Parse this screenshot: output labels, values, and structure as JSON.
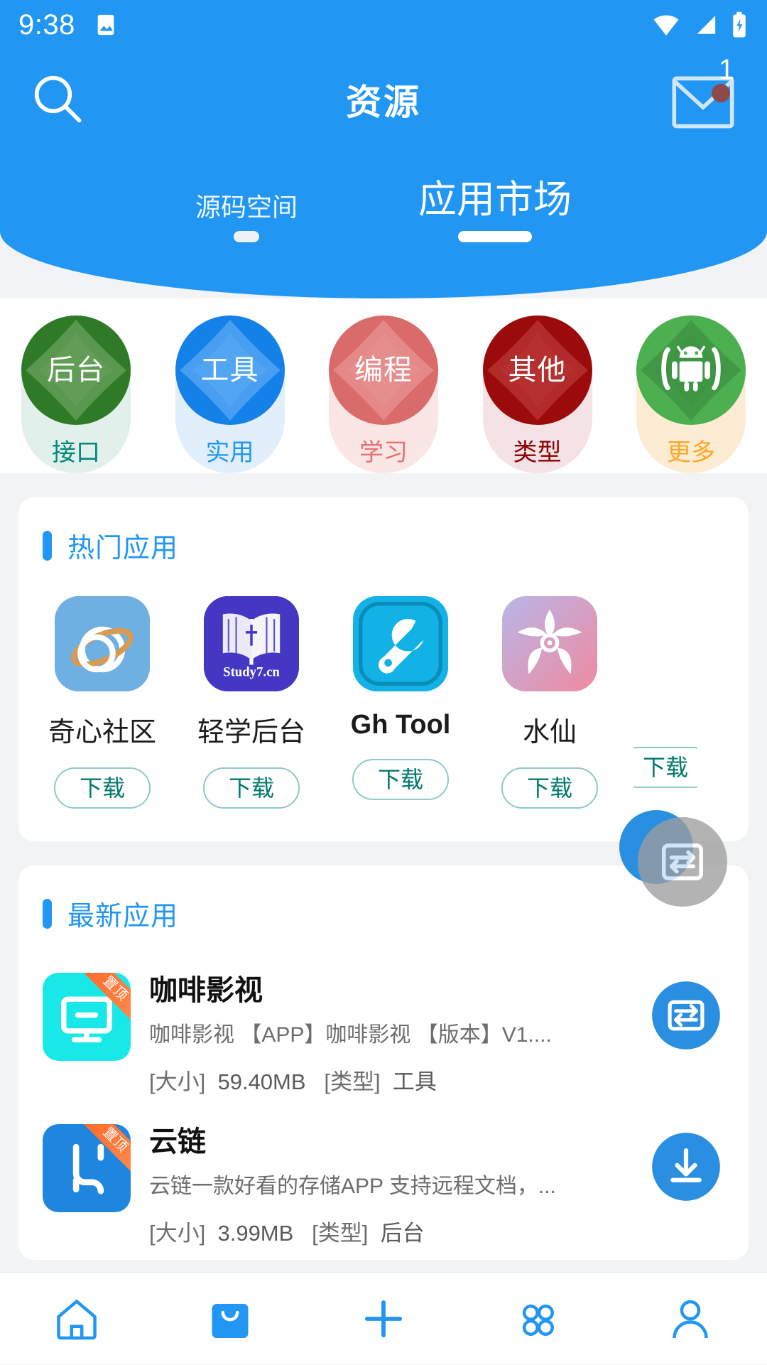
{
  "statusbar": {
    "time": "9:38",
    "icons": [
      "image-icon",
      "wifi-icon",
      "signal-icon",
      "battery-icon"
    ]
  },
  "header": {
    "title": "资源",
    "search_icon": "search-icon",
    "mail_icon": "mail-icon",
    "mail_badge": "1",
    "accent": "#2196f3",
    "tabs": [
      {
        "label": "源码空间",
        "active": false
      },
      {
        "label": "应用市场",
        "active": true
      }
    ]
  },
  "categories": [
    {
      "icon_text": "后台",
      "label": "接口",
      "circle": "#2f7a27",
      "petal": "#6aa35e",
      "pill": "#e2f0ec",
      "label_color": "#00897b"
    },
    {
      "icon_text": "工具",
      "label": "实用",
      "circle": "#1481e8",
      "petal": "#59a9f4",
      "pill": "#e1effc",
      "label_color": "#2196f3"
    },
    {
      "icon_text": "编程",
      "label": "学习",
      "circle": "#d96b6b",
      "petal": "#e89292",
      "pill": "#fae6e4",
      "label_color": "#e57373"
    },
    {
      "icon_text": "其他",
      "label": "类型",
      "circle": "#9c0b0b",
      "petal": "#b93535",
      "pill": "#f4e2e4",
      "label_color": "#8b0000"
    },
    {
      "icon_text": "android-robot-icon",
      "label": "更多",
      "circle": "#4caf50",
      "petal": "#3d9142",
      "pill": "#fcecd4",
      "label_color": "#ffa726"
    }
  ],
  "hot_section": {
    "title": "热门应用",
    "apps": [
      {
        "name": "奇心社区",
        "download_label": "下载",
        "icon": "planet-ring-icon",
        "bg": "#6fb0e3",
        "latin": false
      },
      {
        "name": "轻学后台",
        "download_label": "下载",
        "icon": "open-book-icon",
        "bg": "#4437c4",
        "badge_text": "Study7.cn",
        "latin": false
      },
      {
        "name": "Gh Tool",
        "download_label": "下载",
        "icon": "wrench-icon",
        "bg": "#12b2e6",
        "latin": true
      },
      {
        "name": "水仙",
        "download_label": "下载",
        "icon": "flower-icon",
        "bg": "#d9a8c8",
        "latin": false
      },
      {
        "name": "",
        "download_label": "下载",
        "icon": "partial-icon",
        "bg": "#ffffff",
        "latin": false
      }
    ]
  },
  "latest_section": {
    "title": "最新应用",
    "size_key": "[大小]",
    "type_key": "[类型]",
    "items": [
      {
        "name": "咖啡影视",
        "desc": "咖啡影视 【APP】咖啡影视 【版本】V1....",
        "size": "59.40MB",
        "type": "工具",
        "ribbon": "置顶",
        "icon": "monitor-icon",
        "icon_bg": "#18e8e8",
        "action_icon": "installed-icon"
      },
      {
        "name": "云链",
        "desc": "云链一款好看的存储APP 支持远程文档，...",
        "size": "3.99MB",
        "type": "后台",
        "ribbon": "置顶",
        "icon": "cloud-link-icon",
        "icon_bg": "#1f86e0",
        "action_icon": "download-arrow-icon"
      }
    ]
  },
  "fab": {
    "icon": "refresh-swap-icon"
  },
  "bottom_nav": [
    {
      "name": "home",
      "icon": "home-icon",
      "active": false
    },
    {
      "name": "store",
      "icon": "shopping-bag-icon",
      "active": true
    },
    {
      "name": "add",
      "icon": "plus-icon",
      "active": false
    },
    {
      "name": "grid",
      "icon": "grid-apps-icon",
      "active": false
    },
    {
      "name": "profile",
      "icon": "person-icon",
      "active": false
    }
  ]
}
